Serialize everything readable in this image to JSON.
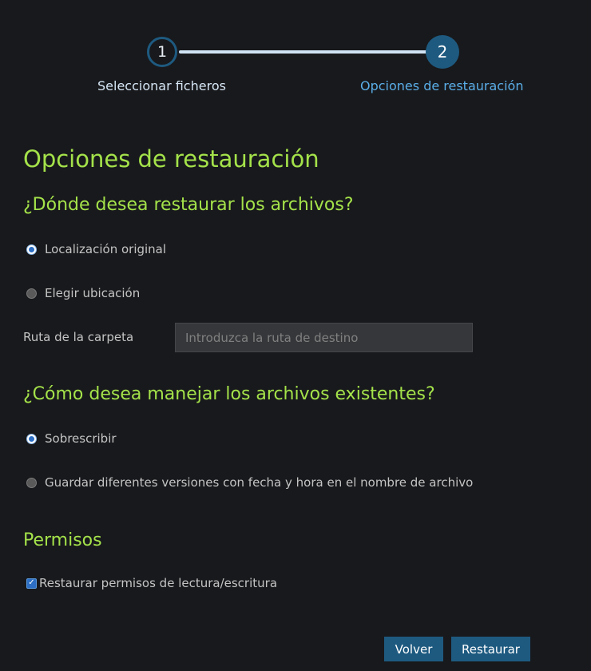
{
  "stepper": {
    "steps": [
      {
        "number": "1",
        "label": "Seleccionar ficheros",
        "state": "completed"
      },
      {
        "number": "2",
        "label": "Opciones de restauración",
        "state": "active"
      }
    ]
  },
  "page_title": "Opciones de restauración",
  "restore_location": {
    "question": "¿Dónde desea restaurar los archivos?",
    "options": [
      {
        "label": "Localización original",
        "selected": true
      },
      {
        "label": "Elegir ubicación",
        "selected": false
      }
    ],
    "folder_path": {
      "label": "Ruta de la carpeta",
      "value": "",
      "placeholder": "Introduzca la ruta de destino"
    }
  },
  "existing_files": {
    "question": "¿Cómo desea manejar los archivos existentes?",
    "options": [
      {
        "label": "Sobrescribir",
        "selected": true
      },
      {
        "label": "Guardar diferentes versiones con fecha y hora en el nombre de archivo",
        "selected": false
      }
    ]
  },
  "permissions": {
    "heading": "Permisos",
    "checkbox_label": "Restaurar permisos de lectura/escritura",
    "checked": true
  },
  "buttons": {
    "back_label": "Volver",
    "restore_label": "Restaurar"
  },
  "colors": {
    "background": "#18191c",
    "accent_green": "#a4e24a",
    "primary_blue": "#1e5a80",
    "link_blue": "#5aaee8"
  }
}
